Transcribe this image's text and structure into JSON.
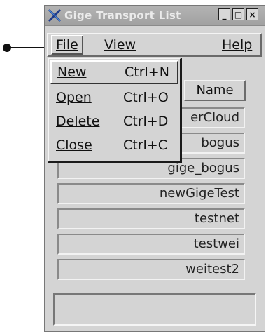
{
  "window": {
    "title": "Gige Transport List",
    "controls": {
      "minimize": "_",
      "maximize": "□",
      "close": "×"
    }
  },
  "menubar": {
    "file": "File",
    "view": "View",
    "help": "Help"
  },
  "file_menu": {
    "items": [
      {
        "label": "New",
        "shortcut": "Ctrl+N"
      },
      {
        "label": "Open",
        "shortcut": "Ctrl+O"
      },
      {
        "label": "Delete",
        "shortcut": "Ctrl+D"
      },
      {
        "label": "Close",
        "shortcut": "Ctrl+C"
      }
    ]
  },
  "list": {
    "header": "Name",
    "rows": [
      "erCloud",
      "bogus",
      "gige_bogus",
      "newGigeTest",
      "testnet",
      "testwei",
      "weitest2"
    ]
  },
  "status": {
    "text": ""
  }
}
